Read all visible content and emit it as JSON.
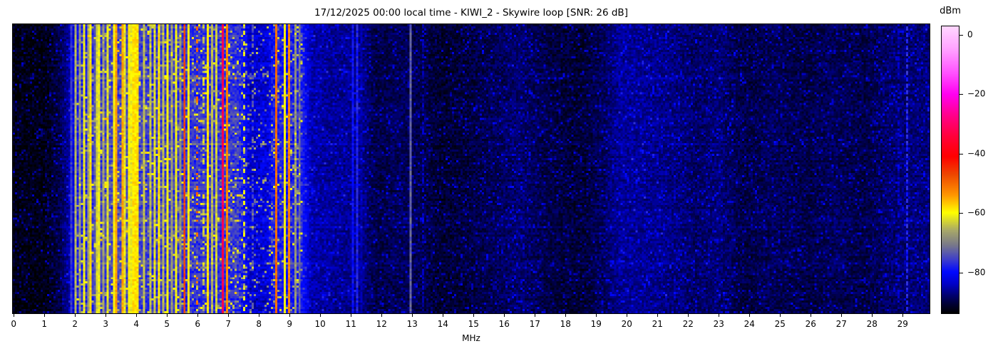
{
  "chart_data": {
    "type": "heatmap",
    "title": "17/12/2025 00:00 local time - KIWI_2 - Skywire loop [SNR: 26 dB]",
    "xlabel": "MHz",
    "x_range": [
      -0.05,
      29.9
    ],
    "x_ticks": [
      0,
      1,
      2,
      3,
      4,
      5,
      6,
      7,
      8,
      9,
      10,
      11,
      12,
      13,
      14,
      15,
      16,
      17,
      18,
      19,
      20,
      21,
      22,
      23,
      24,
      25,
      26,
      27,
      28,
      29
    ],
    "colorbar": {
      "label": "dBm",
      "tick_values": [
        0,
        -20,
        -40,
        -60,
        -80
      ],
      "tick_labels": [
        "0",
        "−20",
        "−40",
        "−60",
        "−80"
      ],
      "value_range": [
        -94,
        3
      ]
    },
    "colormap_stops": [
      [
        -94,
        0,
        0,
        0
      ],
      [
        -91,
        0,
        0,
        50
      ],
      [
        -88,
        0,
        0,
        110
      ],
      [
        -84,
        0,
        0,
        200
      ],
      [
        -80,
        0,
        8,
        255
      ],
      [
        -76,
        60,
        60,
        205
      ],
      [
        -71,
        120,
        120,
        138
      ],
      [
        -66,
        168,
        168,
        105
      ],
      [
        -60,
        255,
        255,
        0
      ],
      [
        -54,
        255,
        150,
        0
      ],
      [
        -47,
        238,
        70,
        0
      ],
      [
        -41,
        255,
        0,
        0
      ],
      [
        -34,
        255,
        0,
        60
      ],
      [
        -27,
        255,
        0,
        140
      ],
      [
        -20,
        255,
        0,
        240
      ],
      [
        -13,
        255,
        80,
        255
      ],
      [
        -5,
        255,
        160,
        255
      ],
      [
        3,
        255,
        215,
        255
      ]
    ],
    "base_profile": [
      [
        -0.05,
        -93
      ],
      [
        1.0,
        -93
      ],
      [
        1.5,
        -90
      ],
      [
        1.9,
        -84
      ],
      [
        2.1,
        -78.5
      ],
      [
        2.5,
        -77.5
      ],
      [
        3.1,
        -75.5
      ],
      [
        4.05,
        -75.5
      ],
      [
        4.4,
        -77
      ],
      [
        7.3,
        -77
      ],
      [
        7.55,
        -81
      ],
      [
        7.7,
        -84
      ],
      [
        8.3,
        -83
      ],
      [
        8.45,
        -79
      ],
      [
        9.4,
        -78.5
      ],
      [
        9.7,
        -85.5
      ],
      [
        10.3,
        -86.5
      ],
      [
        11.35,
        -87
      ],
      [
        11.8,
        -90.5
      ],
      [
        12.6,
        -89.5
      ],
      [
        13.3,
        -90
      ],
      [
        14.0,
        -91.5
      ],
      [
        15.0,
        -90.5
      ],
      [
        16.5,
        -88.5
      ],
      [
        17.5,
        -90.5
      ],
      [
        18.5,
        -91.5
      ],
      [
        19.3,
        -89
      ],
      [
        19.8,
        -86.5
      ],
      [
        21.0,
        -87
      ],
      [
        21.8,
        -88
      ],
      [
        22.3,
        -89
      ],
      [
        23.0,
        -88
      ],
      [
        23.8,
        -90.5
      ],
      [
        24.8,
        -89.5
      ],
      [
        25.8,
        -90.5
      ],
      [
        26.8,
        -89.5
      ],
      [
        27.8,
        -90.5
      ],
      [
        28.6,
        -88.5
      ],
      [
        29.9,
        -88
      ]
    ],
    "stripes": [
      {
        "f": 1.47,
        "w": 0.022,
        "lv": -76,
        "st": 1,
        "per": 4,
        "duty": 2
      },
      {
        "f": 1.88,
        "w": 0.015,
        "lv": -71,
        "st": 0
      },
      {
        "f": 2.03,
        "w": 0.03,
        "lv": -61,
        "st": 0
      },
      {
        "f": 2.13,
        "w": 0.02,
        "lv": -65,
        "st": 0
      },
      {
        "f": 2.3,
        "w": 0.03,
        "lv": -59.5,
        "st": 0
      },
      {
        "f": 2.42,
        "w": 0.018,
        "lv": -67,
        "st": 0
      },
      {
        "f": 2.5,
        "w": 0.028,
        "lv": -58,
        "st": 0
      },
      {
        "f": 2.62,
        "w": 0.02,
        "lv": -72,
        "st": 0
      },
      {
        "f": 2.7,
        "w": 0.018,
        "lv": -63,
        "st": 0
      },
      {
        "f": 2.78,
        "w": 0.02,
        "lv": -60,
        "st": 0
      },
      {
        "f": 2.9,
        "w": 0.025,
        "lv": -66,
        "st": 0
      },
      {
        "f": 3.03,
        "w": 0.03,
        "lv": -59.5,
        "st": 0
      },
      {
        "f": 3.14,
        "w": 0.02,
        "lv": -62,
        "st": 0
      },
      {
        "f": 3.23,
        "w": 0.035,
        "lv": -56,
        "st": 0
      },
      {
        "f": 3.34,
        "w": 0.04,
        "lv": -53.5,
        "st": 0
      },
      {
        "f": 3.44,
        "w": 0.025,
        "lv": -59,
        "st": 0
      },
      {
        "f": 3.53,
        "w": 0.035,
        "lv": -54.5,
        "st": 0
      },
      {
        "f": 3.64,
        "w": 0.035,
        "lv": -57,
        "st": 0
      },
      {
        "f": 3.73,
        "w": 0.035,
        "lv": -58,
        "st": 0
      },
      {
        "f": 3.83,
        "w": 0.03,
        "lv": -60,
        "st": 0
      },
      {
        "f": 3.92,
        "w": 0.045,
        "lv": -55,
        "st": 0
      },
      {
        "f": 4.0,
        "w": 0.04,
        "lv": -56,
        "st": 0
      },
      {
        "f": 4.12,
        "w": 0.025,
        "lv": -60,
        "st": 0
      },
      {
        "f": 4.24,
        "w": 0.02,
        "lv": -64,
        "st": 0
      },
      {
        "f": 4.33,
        "w": 0.02,
        "lv": -67,
        "st": 0
      },
      {
        "f": 4.46,
        "w": 0.02,
        "lv": -60,
        "st": 0
      },
      {
        "f": 4.6,
        "w": 0.025,
        "lv": -59.5,
        "st": 0
      },
      {
        "f": 4.72,
        "w": 0.025,
        "lv": -58.5,
        "st": 0
      },
      {
        "f": 4.86,
        "w": 0.018,
        "lv": -65,
        "st": 0
      },
      {
        "f": 5.0,
        "w": 0.02,
        "lv": -60.5,
        "st": 0
      },
      {
        "f": 5.13,
        "w": 0.018,
        "lv": -66,
        "st": 0
      },
      {
        "f": 5.28,
        "w": 0.02,
        "lv": -61,
        "st": 0
      },
      {
        "f": 5.41,
        "w": 0.018,
        "lv": -68,
        "st": 0
      },
      {
        "f": 5.58,
        "w": 0.04,
        "lv": -45,
        "st": 0
      },
      {
        "f": 5.69,
        "w": 0.02,
        "lv": -59,
        "st": 0
      },
      {
        "f": 5.79,
        "w": 0.018,
        "lv": -62,
        "st": 2,
        "p": 0.5
      },
      {
        "f": 5.95,
        "w": 0.025,
        "lv": -44,
        "st": 2,
        "p": 0.16
      },
      {
        "f": 6.08,
        "w": 0.025,
        "lv": -44,
        "st": 2,
        "p": 0.16
      },
      {
        "f": 6.2,
        "w": 0.02,
        "lv": -60,
        "st": 2,
        "p": 0.4
      },
      {
        "f": 6.33,
        "w": 0.028,
        "lv": -58,
        "st": 0
      },
      {
        "f": 6.46,
        "w": 0.02,
        "lv": -65,
        "st": 0
      },
      {
        "f": 6.62,
        "w": 0.022,
        "lv": -59.5,
        "st": 0
      },
      {
        "f": 6.8,
        "w": 0.05,
        "lv": -32,
        "st": 0
      },
      {
        "f": 6.93,
        "w": 0.028,
        "lv": -49,
        "st": 0
      },
      {
        "f": 7.06,
        "w": 0.022,
        "lv": -58,
        "st": 0
      },
      {
        "f": 7.18,
        "w": 0.018,
        "lv": -72,
        "st": 0
      },
      {
        "f": 7.49,
        "w": 0.022,
        "lv": -58,
        "st": 1,
        "per": 5,
        "duty": 2
      },
      {
        "f": 7.78,
        "w": 0.013,
        "lv": -73,
        "st": 2,
        "p": 0.3
      },
      {
        "f": 7.95,
        "w": 0.013,
        "lv": -73,
        "st": 2,
        "p": 0.3
      },
      {
        "f": 8.1,
        "w": 0.013,
        "lv": -74,
        "st": 2,
        "p": 0.25
      },
      {
        "f": 8.55,
        "w": 0.035,
        "lv": -50,
        "st": 0
      },
      {
        "f": 8.72,
        "w": 0.018,
        "lv": -63,
        "st": 0
      },
      {
        "f": 8.83,
        "w": 0.018,
        "lv": -60,
        "st": 0
      },
      {
        "f": 8.97,
        "w": 0.03,
        "lv": -52,
        "st": 0
      },
      {
        "f": 9.07,
        "w": 0.02,
        "lv": -60,
        "st": 0
      },
      {
        "f": 9.2,
        "w": 0.025,
        "lv": -64,
        "st": 0
      },
      {
        "f": 9.33,
        "w": 0.02,
        "lv": -70,
        "st": 0
      },
      {
        "f": 10.9,
        "w": 0.02,
        "lv": -80,
        "st": 0
      },
      {
        "f": 11.05,
        "w": 0.02,
        "lv": -78.5,
        "st": 0
      },
      {
        "f": 11.2,
        "w": 0.018,
        "lv": -78,
        "st": 0
      },
      {
        "f": 11.32,
        "w": 0.018,
        "lv": -80,
        "st": 0
      },
      {
        "f": 12.95,
        "w": 0.014,
        "lv": -70,
        "st": 0
      },
      {
        "f": 13.35,
        "w": 0.013,
        "lv": -83,
        "st": 2,
        "p": 0.5
      },
      {
        "f": 28.9,
        "w": 0.018,
        "lv": -82,
        "st": 2,
        "p": 0.45
      },
      {
        "f": 29.16,
        "w": 0.025,
        "lv": -77,
        "st": 1,
        "per": 3,
        "duty": 2
      }
    ],
    "noise": {
      "active_band": [
        1.95,
        9.45
      ],
      "active": {
        "base": -2.5,
        "span": 5.5,
        "p": 0.13,
        "extra_base": 4,
        "extra_span": 14
      },
      "quiet": {
        "base": -2.0,
        "span": 4.5,
        "p": 0.1,
        "extra_base": 2.5,
        "extra_span": 5
      }
    },
    "rows": 136,
    "cols": 430,
    "seed": 1337
  }
}
